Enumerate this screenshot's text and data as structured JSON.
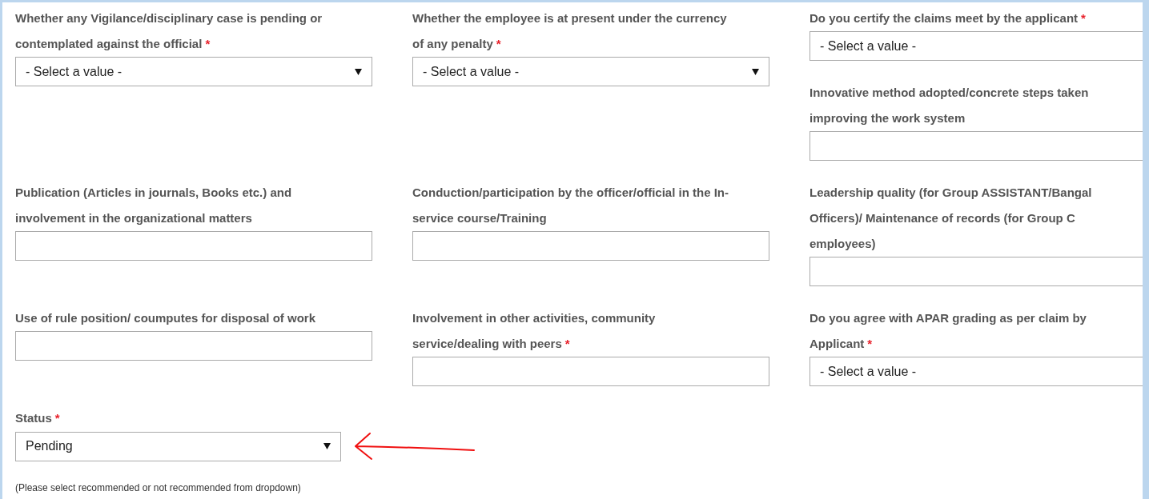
{
  "rows": [
    {
      "cells": [
        {
          "clipped": false,
          "fields": [
            {
              "kind": "select",
              "label_lines": [
                "Whether any Vigilance/disciplinary case is pending or",
                "contemplated against the official"
              ],
              "required_mark": "*",
              "value": "- Select a value -"
            }
          ]
        },
        {
          "clipped": false,
          "fields": [
            {
              "kind": "select",
              "label_lines": [
                "Whether the employee is at present under the currency",
                "of any penalty"
              ],
              "required_mark": "*",
              "value": "- Select a value -"
            }
          ]
        },
        {
          "clipped": true,
          "fields": [
            {
              "kind": "select",
              "label_lines": [
                "Do you certify the claims meet by the applicant"
              ],
              "required_mark": "*",
              "value": "- Select a value -"
            },
            {
              "kind": "text",
              "label_lines": [
                "Innovative method adopted/concrete steps taken",
                "improving the work system"
              ]
            }
          ]
        }
      ]
    },
    {
      "cells": [
        {
          "clipped": false,
          "fields": [
            {
              "kind": "text",
              "label_lines": [
                "Publication (Articles in journals, Books etc.) and",
                "involvement in the organizational matters"
              ]
            }
          ]
        },
        {
          "clipped": false,
          "fields": [
            {
              "kind": "text",
              "label_lines": [
                "Conduction/participation by the officer/official in the In-",
                "service course/Training"
              ]
            }
          ]
        },
        {
          "clipped": true,
          "fields": [
            {
              "kind": "text",
              "label_lines": [
                "Leadership quality (for Group ASSISTANT/Bangal",
                "Officers)/ Maintenance of records (for Group C",
                "employees)"
              ]
            }
          ]
        }
      ]
    },
    {
      "cells": [
        {
          "clipped": false,
          "fields": [
            {
              "kind": "text",
              "label_lines": [
                "Use of rule position/ coumputes for disposal of work"
              ]
            }
          ]
        },
        {
          "clipped": false,
          "fields": [
            {
              "kind": "text",
              "label_lines": [
                "Involvement in other activities, community",
                "service/dealing with peers"
              ],
              "required_mark": "*"
            }
          ]
        },
        {
          "clipped": true,
          "fields": [
            {
              "kind": "select",
              "label_lines": [
                "Do you agree with APAR grading as per claim by",
                "Applicant"
              ],
              "required_mark": "*",
              "value": "- Select a value -"
            }
          ]
        }
      ]
    }
  ],
  "status": {
    "kind": "select",
    "label_lines": [
      "Status"
    ],
    "required_mark": "*",
    "value": "Pending"
  },
  "hint": "(Please select recommended or not recommended from dropdown)"
}
